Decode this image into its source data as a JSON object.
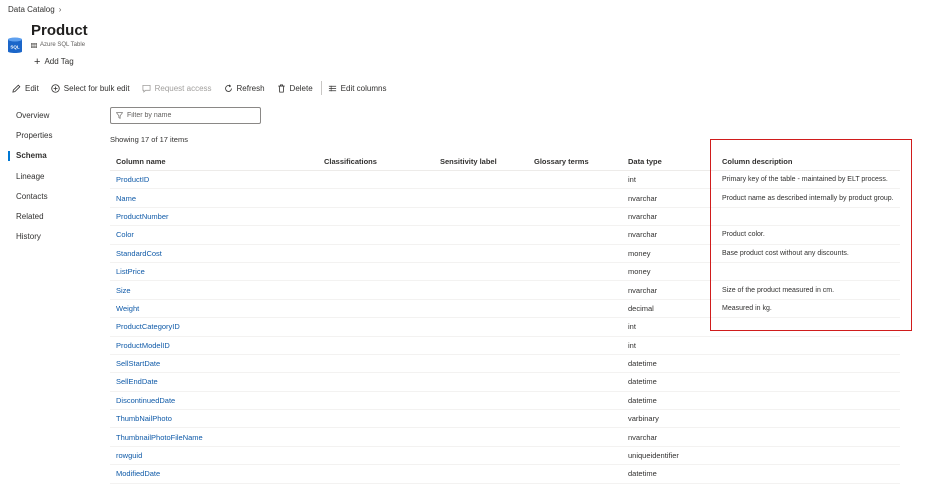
{
  "breadcrumb": {
    "root": "Data Catalog"
  },
  "header": {
    "icon_text": "SQL",
    "title": "Product",
    "subtitle": "Azure SQL Table",
    "add_tag": "Add Tag"
  },
  "toolbar": {
    "edit": "Edit",
    "bulk_edit": "Select for bulk edit",
    "request_access": "Request access",
    "refresh": "Refresh",
    "delete": "Delete",
    "edit_columns": "Edit columns"
  },
  "nav": {
    "items": [
      "Overview",
      "Properties",
      "Schema",
      "Lineage",
      "Contacts",
      "Related",
      "History"
    ],
    "active": "Schema"
  },
  "filter": {
    "placeholder": "Filter by name"
  },
  "showing": "Showing 17 of 17 items",
  "table": {
    "headers": [
      "Column name",
      "Classifications",
      "Sensitivity label",
      "Glossary terms",
      "Data type",
      "Column description"
    ],
    "rows": [
      {
        "name": "ProductID",
        "type": "int",
        "desc": "Primary key of the table - maintained by ELT process."
      },
      {
        "name": "Name",
        "type": "nvarchar",
        "desc": "Product name as described internally by product group."
      },
      {
        "name": "ProductNumber",
        "type": "nvarchar",
        "desc": ""
      },
      {
        "name": "Color",
        "type": "nvarchar",
        "desc": "Product color."
      },
      {
        "name": "StandardCost",
        "type": "money",
        "desc": "Base product cost without any discounts."
      },
      {
        "name": "ListPrice",
        "type": "money",
        "desc": ""
      },
      {
        "name": "Size",
        "type": "nvarchar",
        "desc": "Size of the product measured in cm."
      },
      {
        "name": "Weight",
        "type": "decimal",
        "desc": "Measured in kg."
      },
      {
        "name": "ProductCategoryID",
        "type": "int",
        "desc": ""
      },
      {
        "name": "ProductModelID",
        "type": "int",
        "desc": ""
      },
      {
        "name": "SellStartDate",
        "type": "datetime",
        "desc": ""
      },
      {
        "name": "SellEndDate",
        "type": "datetime",
        "desc": ""
      },
      {
        "name": "DiscontinuedDate",
        "type": "datetime",
        "desc": ""
      },
      {
        "name": "ThumbNailPhoto",
        "type": "varbinary",
        "desc": ""
      },
      {
        "name": "ThumbnailPhotoFileName",
        "type": "nvarchar",
        "desc": ""
      },
      {
        "name": "rowguid",
        "type": "uniqueidentifier",
        "desc": ""
      },
      {
        "name": "ModifiedDate",
        "type": "datetime",
        "desc": ""
      }
    ]
  },
  "colors": {
    "link": "#0f5aa8",
    "accent": "#0078d4",
    "highlight_border": "#d01c1c"
  }
}
